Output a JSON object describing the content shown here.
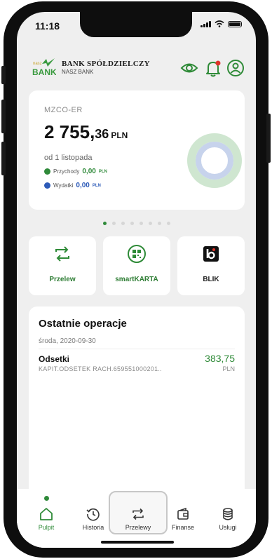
{
  "status": {
    "time": "11:18"
  },
  "bank": {
    "name_line1": "BANK SPÓŁDZIELCZY",
    "name_line2": "NASZ BANK",
    "logo_small": "nasz",
    "logo_big": "BANK"
  },
  "header_icons": [
    "eye-icon",
    "bell-icon",
    "user-icon"
  ],
  "account": {
    "name": "MZCO-ER",
    "balance_int": "2 755,",
    "balance_dec": "36",
    "currency": "PLN",
    "period": "od 1 listopada",
    "income_label": "Przychody",
    "income_value": "0,00",
    "income_currency": "PLN",
    "expense_label": "Wydatki",
    "expense_value": "0,00",
    "expense_currency": "PLN",
    "income_color": "#2f8a3a",
    "expense_color": "#2d5bb8"
  },
  "carousel": {
    "count": 8,
    "active_index": 0
  },
  "quick_actions": [
    {
      "label": "Przelew",
      "icon": "transfer-icon"
    },
    {
      "label": "smartKARTA",
      "icon": "qr-card-icon"
    },
    {
      "label": "BLIK",
      "icon": "blik-icon"
    }
  ],
  "recent": {
    "title": "Ostatnie operacje",
    "date": "środa, 2020-09-30",
    "operation": {
      "title": "Odsetki",
      "description": "KAPIT.ODSETEK RACH.659551000201..",
      "amount": "383,75",
      "currency": "PLN"
    }
  },
  "bottom_nav": [
    {
      "label": "Pulpit",
      "icon": "home-icon",
      "active": true
    },
    {
      "label": "Historia",
      "icon": "history-icon",
      "active": false
    },
    {
      "label": "Przelewy",
      "icon": "transfer-icon",
      "active": false
    },
    {
      "label": "Finanse",
      "icon": "wallet-icon",
      "active": false
    },
    {
      "label": "Usługi",
      "icon": "database-icon",
      "active": false
    }
  ],
  "colors": {
    "brand_green": "#2f8a3a",
    "accent_blue": "#2d5bb8"
  }
}
